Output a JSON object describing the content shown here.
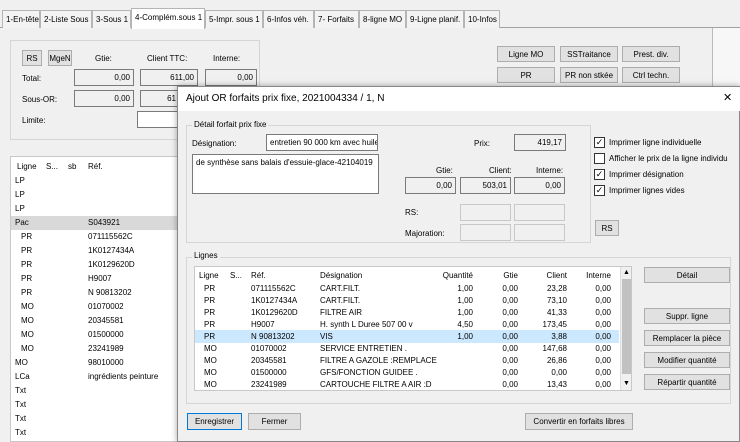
{
  "tabs": [
    {
      "label": "1-En-tête"
    },
    {
      "label": "2-Liste Sous"
    },
    {
      "label": "3-Sous 1"
    },
    {
      "label": "4-Complém.sous 1"
    },
    {
      "label": "5-Impr. sous 1"
    },
    {
      "label": "6-Infos véh."
    },
    {
      "label": "7- Forfaits"
    },
    {
      "label": "8-ligne MO"
    },
    {
      "label": "9-Ligne planif."
    },
    {
      "label": "10-Infos"
    }
  ],
  "totals": {
    "rs_btn": "RS",
    "mgen_btn": "MgeN",
    "col_gtie": "Gtie:",
    "col_client": "Client TTC:",
    "col_interne": "Interne:",
    "total_label": "Total:",
    "total_gtie": "0,00",
    "total_client": "611,00",
    "total_interne": "0,00",
    "sousor_label": "Sous-OR:",
    "sousor_gtie": "0,00",
    "sousor_client": "61",
    "limite_label": "Limite:"
  },
  "right_buttons": [
    "Ligne MO",
    "SSTraitance",
    "Prest. div.",
    "PR",
    "PR non stkée",
    "Ctrl techn."
  ],
  "left_list": {
    "headers": [
      "Ligne",
      "S...",
      "sb",
      "Réf."
    ],
    "rows": [
      {
        "ligne": "LP",
        "ref": ""
      },
      {
        "ligne": "LP",
        "ref": ""
      },
      {
        "ligne": "LP",
        "ref": ""
      },
      {
        "ligne": "Pac",
        "ref": "S043921"
      },
      {
        "ligne": "PR",
        "ref": "071115562C"
      },
      {
        "ligne": "PR",
        "ref": "1K0127434A"
      },
      {
        "ligne": "PR",
        "ref": "1K0129620D"
      },
      {
        "ligne": "PR",
        "ref": "H9007"
      },
      {
        "ligne": "PR",
        "ref": "N  90813202"
      },
      {
        "ligne": "MO",
        "ref": "01070002"
      },
      {
        "ligne": "MO",
        "ref": "20345581"
      },
      {
        "ligne": "MO",
        "ref": "01500000"
      },
      {
        "ligne": "MO",
        "ref": "23241989"
      },
      {
        "ligne": "MO",
        "ref": "98010000"
      },
      {
        "ligne": "LCa",
        "ref": "ingrédients peinture"
      },
      {
        "ligne": "Txt",
        "ref": ""
      },
      {
        "ligne": "Txt",
        "ref": ""
      },
      {
        "ligne": "Txt",
        "ref": ""
      },
      {
        "ligne": "Txt",
        "ref": ""
      }
    ]
  },
  "dialog": {
    "title": "Ajout OR forfaits prix fixe, 2021004334 / 1, N",
    "detail_group": "Détail forfait prix fixe",
    "designation_label": "Désignation:",
    "designation_value": "entretien 90 000 km avec huile",
    "designation_extra": "de synthèse sans balais d'essuie-glace-42104019",
    "prix_label": "Prix:",
    "prix_value": "419,17",
    "col_gtie": "Gtie:",
    "col_client": "Client:",
    "col_interne": "Interne:",
    "gtie_value": "0,00",
    "client_value": "503,01",
    "interne_value": "0,00",
    "rs_label": "RS:",
    "majoration_label": "Majoration:",
    "rs_btn": "RS",
    "checkboxes": [
      {
        "label": "Imprimer ligne individuelle",
        "checked": "✓"
      },
      {
        "label": "Afficher le prix de la ligne individu",
        "checked": ""
      },
      {
        "label": "Imprimer désignation",
        "checked": "✓"
      },
      {
        "label": "Imprimer lignes vides",
        "checked": "✓"
      }
    ],
    "lignes_group": "Lignes",
    "table_headers": [
      "Ligne",
      "S...",
      "Réf.",
      "Désignation",
      "Quantité",
      "Gtie",
      "Client",
      "Interne"
    ],
    "rows": [
      {
        "ligne": "PR",
        "ref": "071115562C",
        "desig": "CART.FILT.",
        "qte": "1,00",
        "gtie": "0,00",
        "client": "23,28",
        "interne": "0,00"
      },
      {
        "ligne": "PR",
        "ref": "1K0127434A",
        "desig": "CART.FILT.",
        "qte": "1,00",
        "gtie": "0,00",
        "client": "73,10",
        "interne": "0,00"
      },
      {
        "ligne": "PR",
        "ref": "1K0129620D",
        "desig": "FILTRE AIR",
        "qte": "1,00",
        "gtie": "0,00",
        "client": "41,33",
        "interne": "0,00"
      },
      {
        "ligne": "PR",
        "ref": "H9007",
        "desig": "H. synth L Duree 507 00 v",
        "qte": "4,50",
        "gtie": "0,00",
        "client": "173,45",
        "interne": "0,00"
      },
      {
        "ligne": "PR",
        "ref": "N  90813202",
        "desig": "VIS",
        "qte": "1,00",
        "gtie": "0,00",
        "client": "3,88",
        "interne": "0,00"
      },
      {
        "ligne": "MO",
        "ref": "01070002",
        "desig": "SERVICE ENTRETIEN .",
        "qte": "",
        "gtie": "0,00",
        "client": "147,68",
        "interne": "0,00"
      },
      {
        "ligne": "MO",
        "ref": "20345581",
        "desig": "FILTRE A GAZOLE :REMPLACE",
        "qte": "",
        "gtie": "0,00",
        "client": "26,86",
        "interne": "0,00"
      },
      {
        "ligne": "MO",
        "ref": "01500000",
        "desig": "GFS/FONCTION GUIDEE .",
        "qte": "",
        "gtie": "0,00",
        "client": "0,00",
        "interne": "0,00"
      },
      {
        "ligne": "MO",
        "ref": "23241989",
        "desig": "CARTOUCHE FILTRE A AIR :D",
        "qte": "",
        "gtie": "0,00",
        "client": "13,43",
        "interne": "0,00"
      }
    ],
    "side_buttons": [
      "Détail",
      "Suppr. ligne",
      "Remplacer la pièce",
      "Modifier quantité",
      "Répartir quantité"
    ],
    "enregistrer": "Enregistrer",
    "fermer": "Fermer",
    "convertir": "Convertir en forfaits libres",
    "close_glyph": "✕"
  }
}
